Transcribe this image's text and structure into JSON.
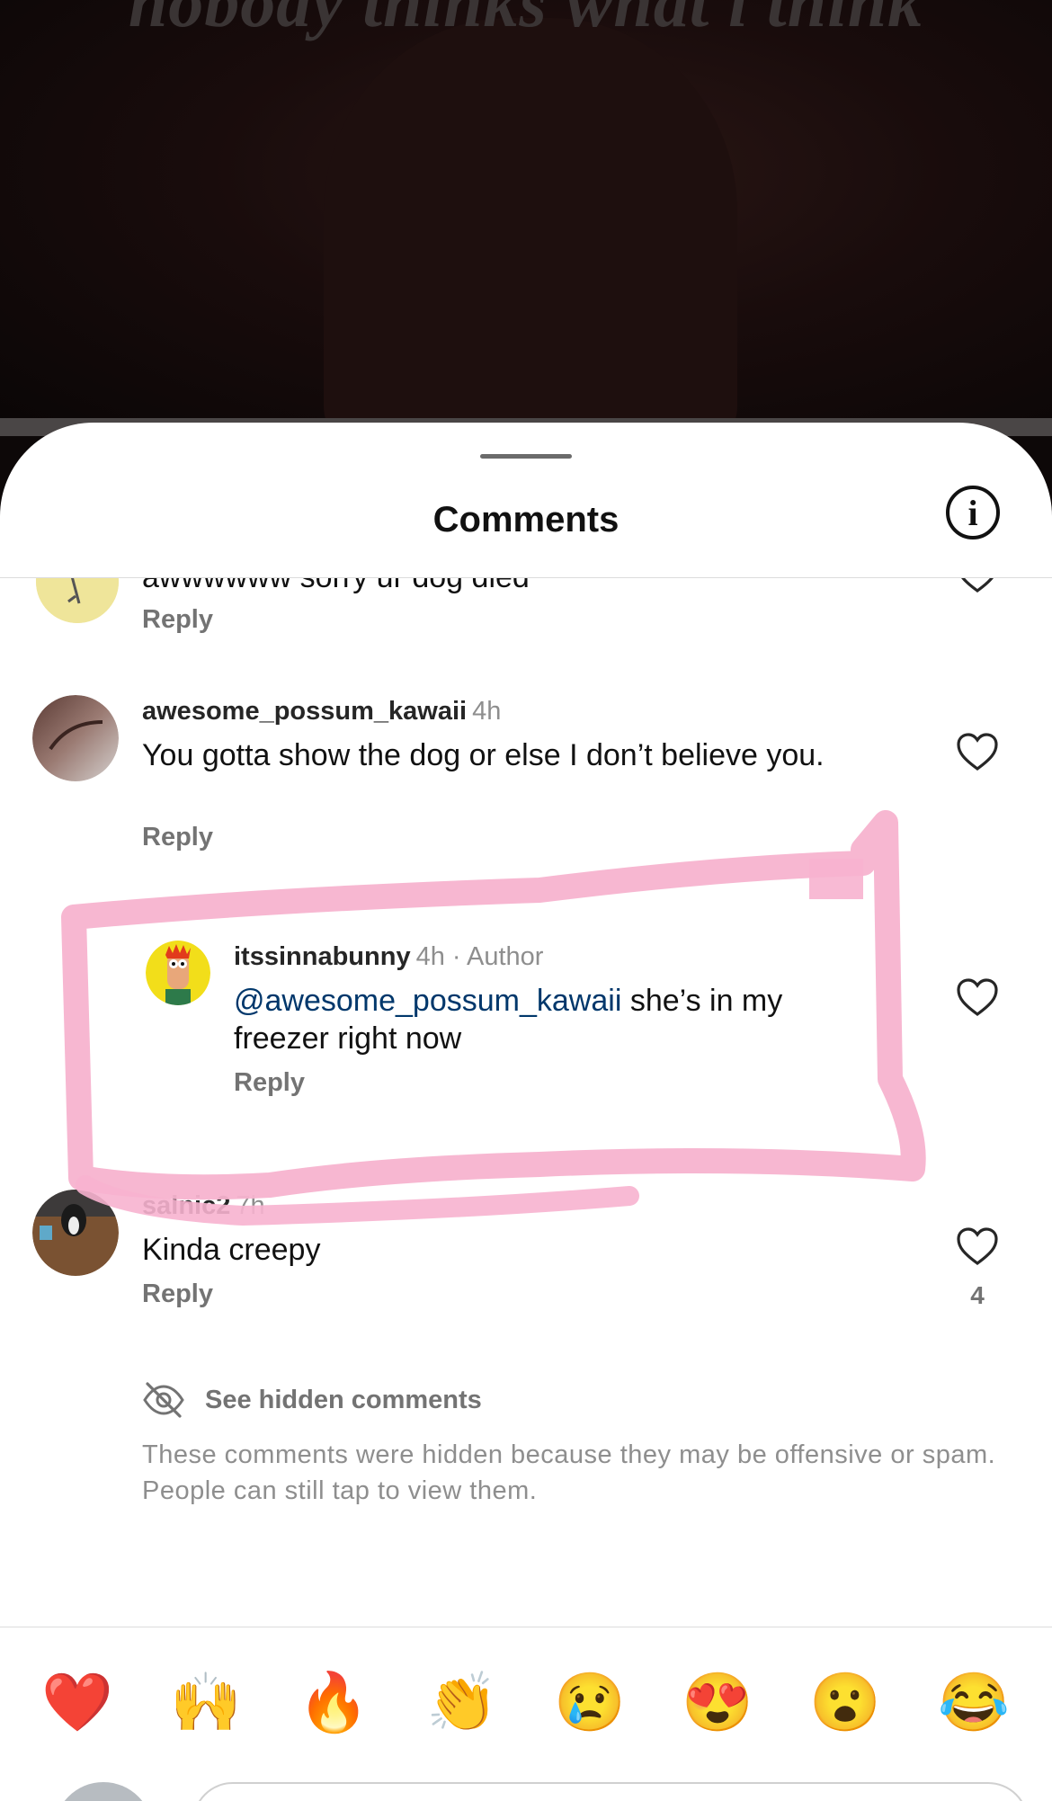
{
  "backdrop": {
    "caption": "nobody thinks what i think"
  },
  "sheet": {
    "title": "Comments",
    "info_icon": "info-icon",
    "info_glyph": "i"
  },
  "comments": [
    {
      "text": "awwwwww sorry ur dog died",
      "reply_label": "Reply",
      "avatar_color": "#efe59a"
    },
    {
      "username": "awesome_possum_kawaii",
      "time": "4h",
      "text": "You gotta show the dog or else I don’t believe you.",
      "reply_label": "Reply",
      "avatar_color": "#8a6458"
    },
    {
      "username": "itssinnabunny",
      "time": "4h",
      "author_tag": "· Author",
      "mention": "@awesome_possum_kawaii",
      "text": " she’s in my freezer right now",
      "reply_label": "Reply",
      "avatar_color": "#f2de1a"
    },
    {
      "username": "salnic2",
      "time": "7h",
      "text": "Kinda creepy",
      "reply_label": "Reply",
      "likes": "4",
      "avatar_color": "#6a4a2e"
    }
  ],
  "hidden": {
    "label": "See hidden comments",
    "icon": "eye-slash-icon",
    "description": "These comments were hidden because they may be offensive or spam. People can still tap to view them."
  },
  "emoji_bar": [
    {
      "name": "red-heart",
      "glyph": "❤️"
    },
    {
      "name": "raising-hands",
      "glyph": "🙌"
    },
    {
      "name": "fire",
      "glyph": "🔥"
    },
    {
      "name": "clapping-hands",
      "glyph": "👏"
    },
    {
      "name": "crying-face",
      "glyph": "😢"
    },
    {
      "name": "heart-eyes",
      "glyph": "😍"
    },
    {
      "name": "surprised-face",
      "glyph": "😮"
    },
    {
      "name": "tears-of-joy",
      "glyph": "😂"
    }
  ],
  "colors": {
    "highlight": "#f7b3cf",
    "mention": "#00376b",
    "muted": "#737373"
  }
}
